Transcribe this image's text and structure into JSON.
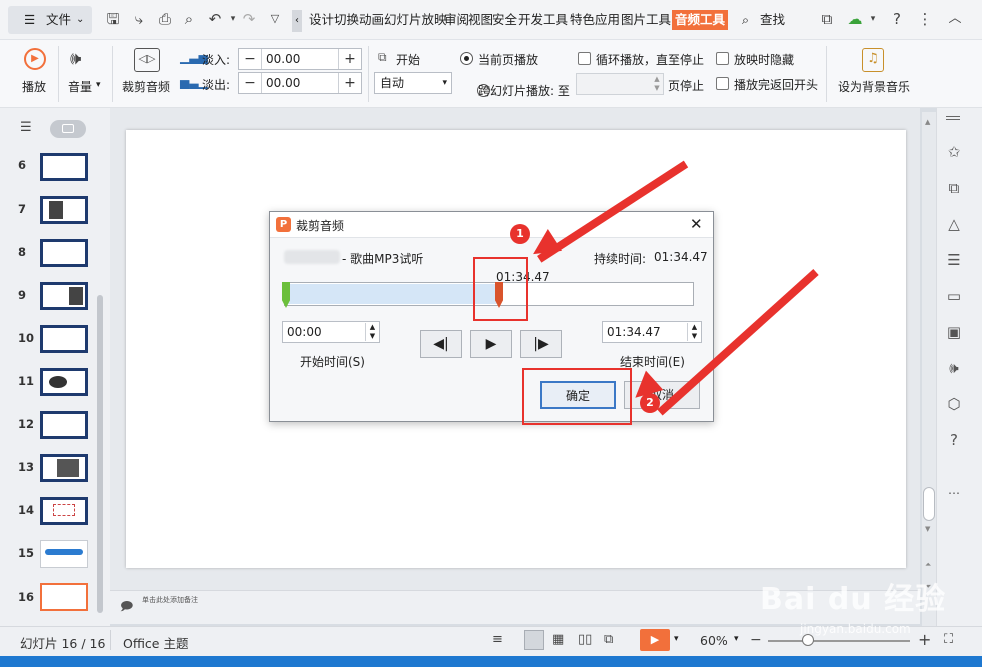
{
  "menu": {
    "file_label": "文件"
  },
  "tabs": [
    "设计",
    "切换",
    "动画",
    "幻灯片放映",
    "审阅",
    "视图",
    "安全",
    "开发工具",
    "特色应用",
    "图片工具",
    "音频工具"
  ],
  "search": {
    "label": "查找"
  },
  "ribbon": {
    "play_label": "播放",
    "volume_label": "音量",
    "trim_label": "裁剪音频",
    "fade_in_label": "淡入:",
    "fade_in_value": "00.00",
    "fade_out_label": "淡出:",
    "fade_out_value": "00.00",
    "start_label": "开始",
    "start_select": "自动",
    "radio_current": "当前页播放",
    "radio_cross": "跨幻灯片播放: 至",
    "page_stop": "页停止",
    "loop_label": "循环播放，直至停止",
    "hide_label": "放映时隐藏",
    "rewind_label": "播放完返回开头",
    "bg_music_label": "设为背景音乐"
  },
  "slides": [
    {
      "num": "6"
    },
    {
      "num": "7"
    },
    {
      "num": "8"
    },
    {
      "num": "9"
    },
    {
      "num": "10"
    },
    {
      "num": "11"
    },
    {
      "num": "12"
    },
    {
      "num": "13"
    },
    {
      "num": "14"
    },
    {
      "num": "15"
    },
    {
      "num": "16"
    }
  ],
  "notes": {
    "placeholder": "单击此处添加备注"
  },
  "status": {
    "slide_count": "幻灯片 16 / 16",
    "theme": "Office 主题",
    "zoom": "60%"
  },
  "dialog": {
    "title": "裁剪音频",
    "song_name": "- 歌曲MP3试听",
    "duration_label": "持续时间:",
    "duration_value": "01:34.47",
    "marker_time": "01:34.47",
    "trim_selected_fraction": 1,
    "start_time_value": "00:00",
    "start_time_label": "开始时间(S)",
    "end_time_value": "01:34.47",
    "end_time_label": "结束时间(E)",
    "ok_label": "确定",
    "cancel_label": "取消"
  },
  "annotations": {
    "badge_1": "1",
    "badge_2": "2"
  },
  "colors": {
    "accent": "#f2703b",
    "annotation_red": "#e8322d",
    "dark_blue": "#1e3a6e",
    "trim_fill": "#d5e6f7",
    "trim_marker": "#d9542c",
    "start_marker": "#6bbf3b"
  },
  "watermark": {
    "text": "Bai du 经验",
    "url": "jingyan.baidu.com"
  }
}
